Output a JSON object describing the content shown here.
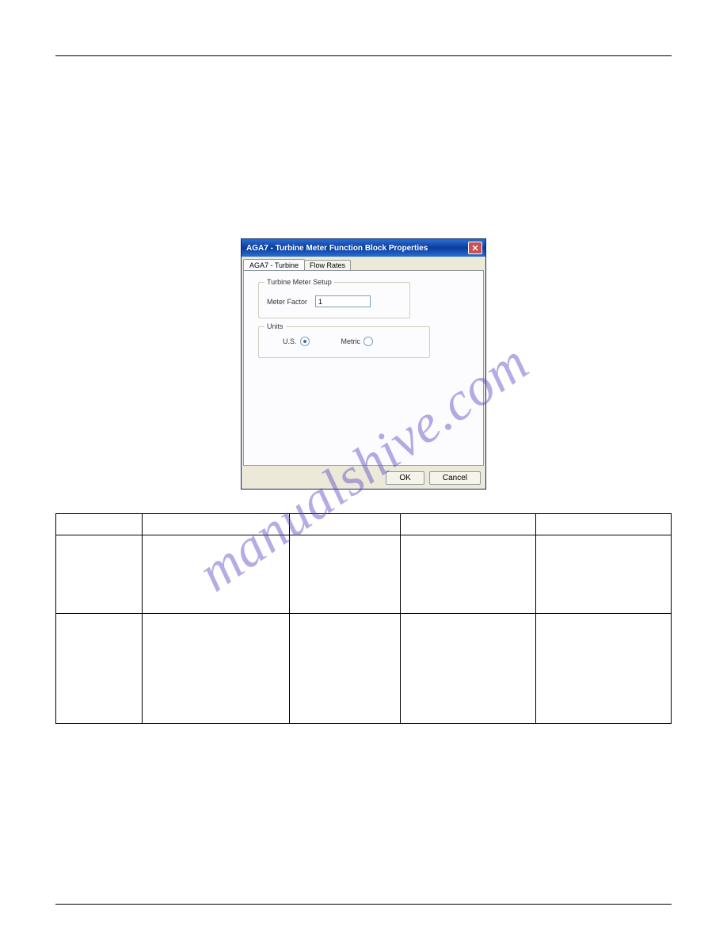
{
  "watermark": "manualshive.com",
  "dialog": {
    "title": "AGA7 - Turbine Meter Function Block Properties",
    "tabs": {
      "active": "AGA7 - Turbine",
      "inactive": "Flow Rates"
    },
    "group1": {
      "title": "Turbine Meter Setup",
      "meter_factor_label": "Meter Factor",
      "meter_factor_value": "1"
    },
    "group2": {
      "title": "Units",
      "us_label": "U.S.",
      "metric_label": "Metric"
    },
    "ok": "OK",
    "cancel": "Cancel"
  },
  "table": {
    "headers": [
      "",
      "",
      "",
      "",
      ""
    ],
    "rows": [
      [
        "",
        "",
        "",
        "",
        ""
      ],
      [
        "",
        "",
        "",
        "",
        ""
      ]
    ]
  }
}
